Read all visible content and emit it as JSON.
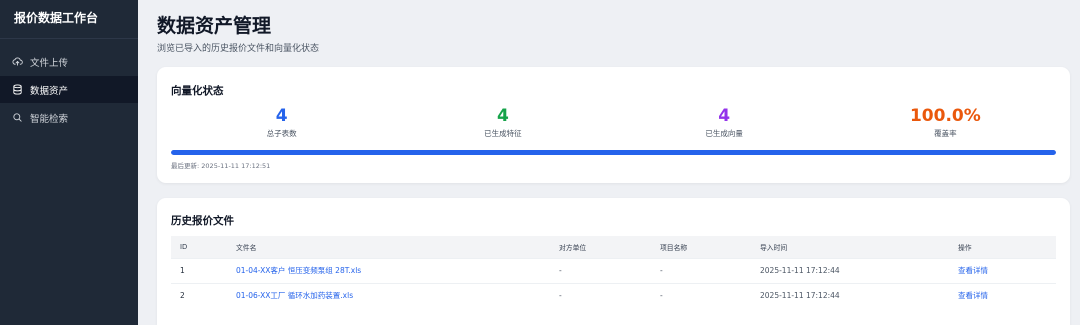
{
  "sidebar": {
    "brand": "报价数据工作台",
    "items": [
      {
        "label": "文件上传",
        "icon": "upload-cloud-icon"
      },
      {
        "label": "数据资产",
        "icon": "database-icon"
      },
      {
        "label": "智能检索",
        "icon": "search-icon"
      }
    ]
  },
  "page": {
    "title": "数据资产管理",
    "subtitle": "浏览已导入的历史报价文件和向量化状态"
  },
  "status": {
    "title": "向量化状态",
    "stats": [
      {
        "value": "4",
        "label": "总子表数",
        "color": "#2563eb"
      },
      {
        "value": "4",
        "label": "已生成特征",
        "color": "#16a34a"
      },
      {
        "value": "4",
        "label": "已生成向量",
        "color": "#9333ea"
      },
      {
        "value": "100.0%",
        "label": "覆盖率",
        "color": "#ea580c"
      }
    ],
    "progress_fraction": 1.0,
    "updated_label": "最后更新:",
    "updated_value": "2025-11-11 17:12:51"
  },
  "files": {
    "title": "历史报价文件",
    "columns": [
      "ID",
      "文件名",
      "对方单位",
      "项目名称",
      "导入时间",
      "操作"
    ],
    "rows": [
      {
        "id": "1",
        "file": "01-04-XX客户 恒压变频泵组 28T.xls",
        "party": "-",
        "project": "-",
        "time": "2025-11-11 17:12:44",
        "action": "查看详情"
      },
      {
        "id": "2",
        "file": "01-06-XX工厂 循环水加药装置.xls",
        "party": "-",
        "project": "-",
        "time": "2025-11-11 17:12:44",
        "action": "查看详情"
      }
    ]
  },
  "colors": {
    "accent": "#2563eb",
    "sidebar": "#1f2937"
  }
}
